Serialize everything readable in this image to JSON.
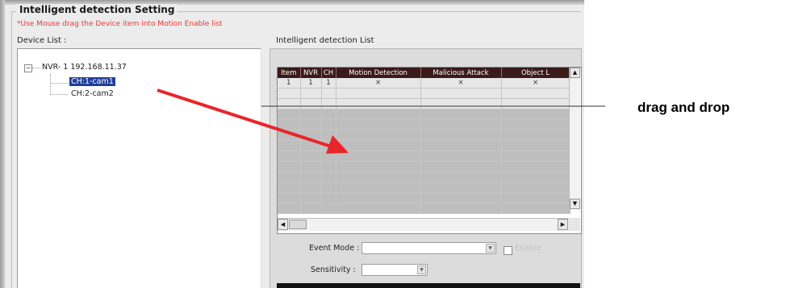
{
  "group": {
    "title": "Intelligent detection Setting",
    "hint": "*Use Mouse drag the Device item into Motion Enable list"
  },
  "device_list": {
    "label": "Device List :",
    "nvr": "NVR- 1 192.168.11.37",
    "cams": [
      "CH:1-cam1",
      "CH:2-cam2"
    ],
    "expander_symbol": "−"
  },
  "intelligent_list": {
    "label": "Intelligent detection List",
    "columns": [
      "Item",
      "NVR",
      "CH",
      "Motion Detection",
      "Malicious Attack",
      "Object L"
    ],
    "rows": [
      [
        "1",
        "1",
        "1",
        "×",
        "×",
        "×"
      ]
    ]
  },
  "form": {
    "event_mode_label": "Event Mode :",
    "enable_label": "Enable",
    "sensitivity_label": "Sensitivity :"
  },
  "bottom_text": "",
  "annotation": {
    "text": "drag and drop",
    "arrow_color": "#e8262a",
    "line_color": "#333333"
  },
  "colors": {
    "header_bg": "#3a1a1a",
    "selection": "#1f3f9a",
    "hint": "#e03b3b"
  }
}
